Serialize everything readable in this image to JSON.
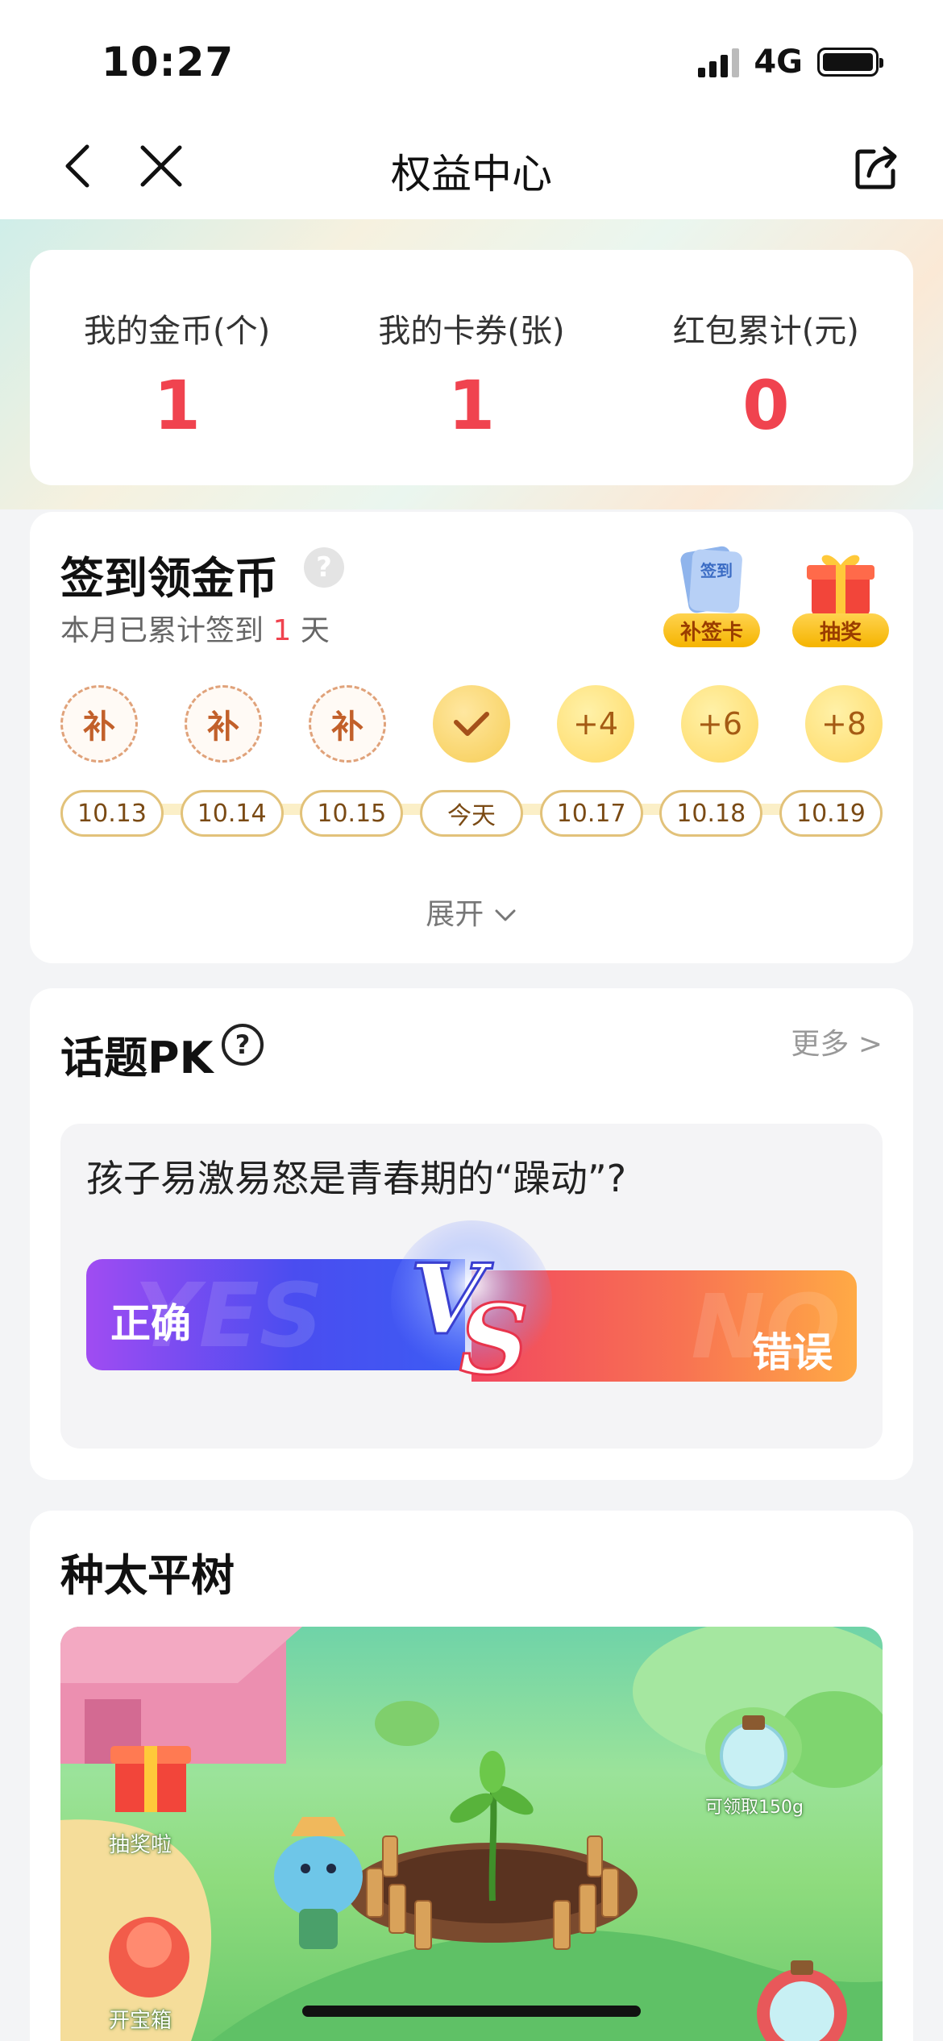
{
  "status_bar": {
    "time": "10:27",
    "network": "4G"
  },
  "nav": {
    "title": "权益中心"
  },
  "stats": [
    {
      "label": "我的金币(个)",
      "value": "1"
    },
    {
      "label": "我的卡券(张)",
      "value": "1"
    },
    {
      "label": "红包累计(元)",
      "value": "0"
    }
  ],
  "signin": {
    "title": "签到领金币",
    "help": "?",
    "subtitle_prefix": "本月已累计签到",
    "subtitle_count": "1",
    "subtitle_suffix": "天",
    "tools": [
      {
        "label": "补签卡",
        "badge_text": "签到"
      },
      {
        "label": "抽奖"
      }
    ],
    "days": [
      {
        "coin": "补",
        "date": "10.13"
      },
      {
        "coin": "补",
        "date": "10.14"
      },
      {
        "coin": "补",
        "date": "10.15"
      },
      {
        "coin": "",
        "date": "今天"
      },
      {
        "coin": "+4",
        "date": "10.17"
      },
      {
        "coin": "+6",
        "date": "10.18"
      },
      {
        "coin": "+8",
        "date": "10.19"
      }
    ],
    "expand": "展开"
  },
  "pk": {
    "title": "话题PK",
    "help": "?",
    "more": "更多 >",
    "question": "孩子易激易怒是青春期的“躁动”?",
    "left_option": "正确",
    "right_option": "错误",
    "left_ghost": "YES",
    "right_ghost": "NO"
  },
  "tree": {
    "title": "种太平树",
    "labels": {
      "lottery": "抽奖啦",
      "chest": "开宝箱",
      "collect": "可领取150g"
    }
  },
  "colors": {
    "accent_red": "#f0434f",
    "gold": "#f5b400"
  }
}
